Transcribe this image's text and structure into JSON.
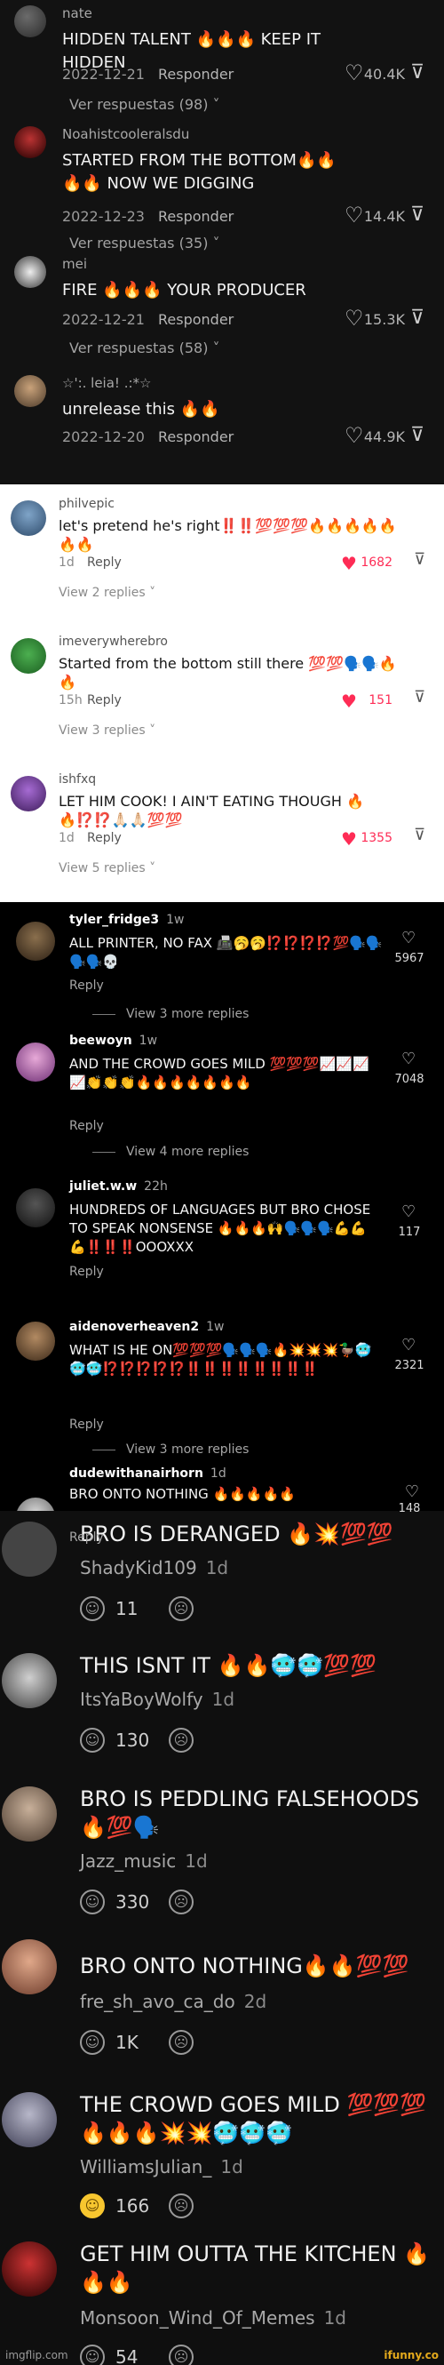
{
  "panel_a": {
    "comments": [
      {
        "user": "nate",
        "text": "HIDDEN TALENT 🔥🔥🔥 KEEP IT HIDDEN",
        "date": "2022-12-21",
        "reply": "Responder",
        "likes": "40.4K",
        "more": "Ver respuestas (98) ˅"
      },
      {
        "user": "Noahistcooleralsdu",
        "text": "STARTED FROM THE BOTTOM🔥🔥🔥🔥 NOW WE DIGGING",
        "date": "2022-12-23",
        "reply": "Responder",
        "likes": "14.4K",
        "more": "Ver respuestas (35) ˅"
      },
      {
        "user": "mei",
        "text": "FIRE 🔥🔥🔥 YOUR PRODUCER",
        "date": "2022-12-21",
        "reply": "Responder",
        "likes": "15.3K",
        "more": "Ver respuestas (58) ˅"
      },
      {
        "user": "☆':. leia! .:*☆",
        "text": "unrelease this 🔥🔥",
        "date": "2022-12-20",
        "reply": "Responder",
        "likes": "44.9K",
        "more": ""
      }
    ]
  },
  "panel_b": {
    "comments": [
      {
        "user": "philvepic",
        "text": "let's pretend he's right‼️‼️💯💯💯🔥🔥🔥🔥🔥🔥🔥",
        "time": "1d",
        "reply": "Reply",
        "likes": "1682",
        "more": "View 2 replies ˅"
      },
      {
        "user": "imeverywherebro",
        "text": "Started from the bottom still there 💯💯🗣️🗣️🔥🔥",
        "time": "15h",
        "reply": "Reply",
        "likes": "151",
        "more": "View 3 replies ˅"
      },
      {
        "user": "ishfxq",
        "text": "LET HIM COOK! I AIN'T EATING THOUGH 🔥🔥⁉️⁉️🙏🏻🙏🏻💯💯",
        "time": "1d",
        "reply": "Reply",
        "likes": "1355",
        "more": "View 5 replies ˅"
      }
    ]
  },
  "panel_c": {
    "comments": [
      {
        "user": "tyler_fridge3",
        "time": "1w",
        "text": "ALL PRINTER, NO FAX 📠🥱🥱⁉️⁉️⁉️⁉️💯🗣️🗣️🗣️🗣️💀",
        "reply": "Reply",
        "likes": "5967",
        "more": "View 3 more replies"
      },
      {
        "user": "beewoyn",
        "time": "1w",
        "text": "AND THE CROWD GOES MILD 💯💯💯📈📈📈📈👏👏👏🔥🔥🔥🔥🔥🔥🔥",
        "reply": "Reply",
        "likes": "7048",
        "more": "View 4 more replies"
      },
      {
        "user": "juliet.w.w",
        "time": "22h",
        "text": "HUNDREDS OF LANGUAGES BUT BRO CHOSE TO SPEAK NONSENSE 🔥🔥🔥🙌🗣️🗣️🗣️💪💪💪‼️‼️‼️OOOXXX",
        "reply": "Reply",
        "likes": "117",
        "more": ""
      },
      {
        "user": "aidenoverheaven2",
        "time": "1w",
        "text": "WHAT IS HE ON💯💯💯🗣️🗣️🗣️🔥💥💥💥🦆🥶🥶🥶⁉️⁉️⁉️⁉️⁉️‼️‼️‼️‼️‼️‼️‼️‼️",
        "reply": "Reply",
        "likes": "2321",
        "more": "View 3 more replies"
      },
      {
        "user": "dudewithanairhorn",
        "time": "1d",
        "text": "BRO ONTO NOTHING 🔥🔥🔥🔥🔥",
        "reply": "Reply",
        "likes": "148",
        "more": ""
      }
    ]
  },
  "panel_d": {
    "comments": [
      {
        "text": "BRO IS DERANGED 🔥💥💯💯",
        "author": "ShadyKid109",
        "time": "1d",
        "likes": "11"
      },
      {
        "text": "THIS ISNT IT 🔥🔥🥶🥶💯💯",
        "author": "ItsYaBoyWolfy",
        "time": "1d",
        "likes": "130"
      },
      {
        "text": "BRO IS PEDDLING FALSEHOODS 🔥💯🗣️",
        "author": "Jazz_music",
        "time": "1d",
        "likes": "330"
      },
      {
        "text": "BRO ONTO NOTHING🔥🔥💯💯",
        "author": "fre_sh_avo_ca_do",
        "time": "2d",
        "likes": "1K"
      },
      {
        "text": "THE CROWD GOES MILD 💯💯💯🔥🔥🔥💥💥🥶🥶🥶",
        "author": "WilliamsJulian_",
        "time": "1d",
        "likes": "166"
      },
      {
        "text": "GET HIM OUTTA THE KITCHEN 🔥🔥🔥",
        "author": "Monsoon_Wind_Of_Memes",
        "time": "1d",
        "likes": "54"
      }
    ]
  },
  "footer": {
    "left": "imgflip.com",
    "right": "ifunny.co"
  },
  "colors": {
    "tiktok_red": "#fe2c55",
    "like_yellow": "#f7c62f"
  }
}
